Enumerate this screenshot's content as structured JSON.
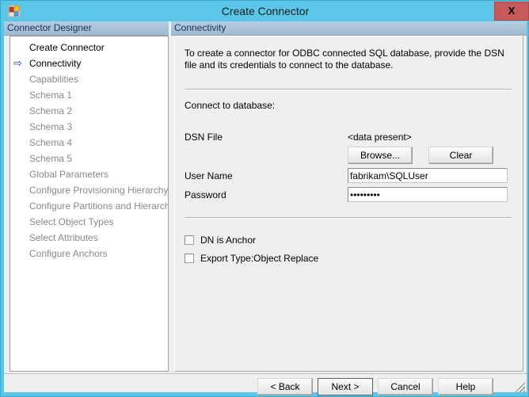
{
  "window": {
    "title": "Create Connector",
    "icon": "connector-app-icon",
    "close_label": "X",
    "accent_color": "#5bc6e8",
    "close_color": "#c75b5b"
  },
  "sidebar": {
    "header": "Connector Designer",
    "current_marker": "⇨",
    "items": [
      {
        "label": "Create Connector",
        "state": "done"
      },
      {
        "label": "Connectivity",
        "state": "current"
      },
      {
        "label": "Capabilities",
        "state": "disabled"
      },
      {
        "label": "Schema 1",
        "state": "disabled"
      },
      {
        "label": "Schema 2",
        "state": "disabled"
      },
      {
        "label": "Schema 3",
        "state": "disabled"
      },
      {
        "label": "Schema 4",
        "state": "disabled"
      },
      {
        "label": "Schema 5",
        "state": "disabled"
      },
      {
        "label": "Global Parameters",
        "state": "disabled"
      },
      {
        "label": "Configure Provisioning Hierarchy",
        "state": "disabled"
      },
      {
        "label": "Configure Partitions and Hierarchies",
        "state": "disabled"
      },
      {
        "label": "Select Object Types",
        "state": "disabled"
      },
      {
        "label": "Select Attributes",
        "state": "disabled"
      },
      {
        "label": "Configure Anchors",
        "state": "disabled"
      }
    ]
  },
  "content": {
    "header": "Connectivity",
    "description": "To create a connector for ODBC connected SQL database, provide the DSN file and its credentials to connect to the database.",
    "section_label": "Connect to database:",
    "fields": {
      "dsn_label": "DSN File",
      "dsn_value": "<data present>",
      "browse_label": "Browse...",
      "clear_label": "Clear",
      "user_label": "User Name",
      "user_value": "fabrikam\\SQLUser",
      "password_label": "Password",
      "password_value": "•••••••••"
    },
    "checkboxes": [
      {
        "label": "DN is Anchor",
        "checked": false
      },
      {
        "label": "Export Type:Object Replace",
        "checked": false
      }
    ]
  },
  "footer": {
    "back_label": "< Back",
    "next_label": "Next >",
    "cancel_label": "Cancel",
    "help_label": "Help"
  }
}
